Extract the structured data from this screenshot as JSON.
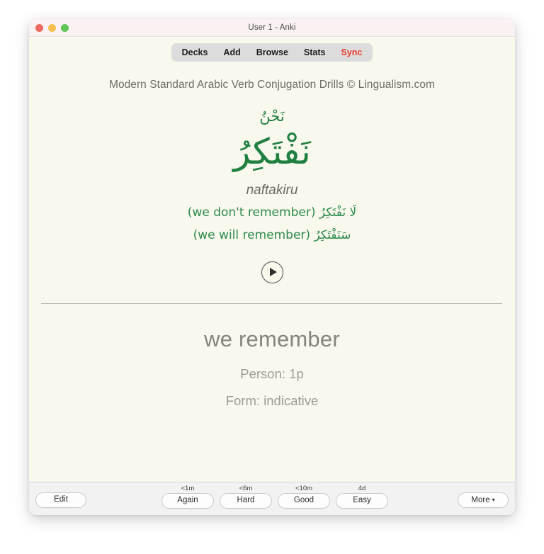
{
  "window": {
    "title": "User 1 - Anki",
    "traffic_lights": [
      "close-button",
      "minimize-button",
      "zoom-button"
    ]
  },
  "toolbar": {
    "items": [
      {
        "label": "Decks",
        "name": "decks"
      },
      {
        "label": "Add",
        "name": "add"
      },
      {
        "label": "Browse",
        "name": "browse"
      },
      {
        "label": "Stats",
        "name": "stats"
      },
      {
        "label": "Sync",
        "name": "sync",
        "color": "#e8392f"
      }
    ]
  },
  "card": {
    "deck_header": "Modern Standard Arabic Verb Conjugation Drills © Lingualism.com",
    "pronoun": "نَحْنُ",
    "verb": "نَفْتَكِرُ",
    "transliteration": "naftakiru",
    "negative_form": "لَا نَفْتَكِرُ (we don't remember)",
    "future_form": "سَنَفْتَكِرُ (we will remember)",
    "play_icon": "play-icon",
    "answer": "we remember",
    "person": "Person: 1p",
    "form": "Form: indicative",
    "accent_green": "#1f8040",
    "background": "#f8f8ed"
  },
  "bottom_bar": {
    "edit_label": "Edit",
    "more_label": "More",
    "more_caret": "▾",
    "ease_buttons": [
      {
        "interval": "<1m",
        "label": "Again"
      },
      {
        "interval": "<6m",
        "label": "Hard"
      },
      {
        "interval": "<10m",
        "label": "Good"
      },
      {
        "interval": "4d",
        "label": "Easy"
      }
    ]
  }
}
